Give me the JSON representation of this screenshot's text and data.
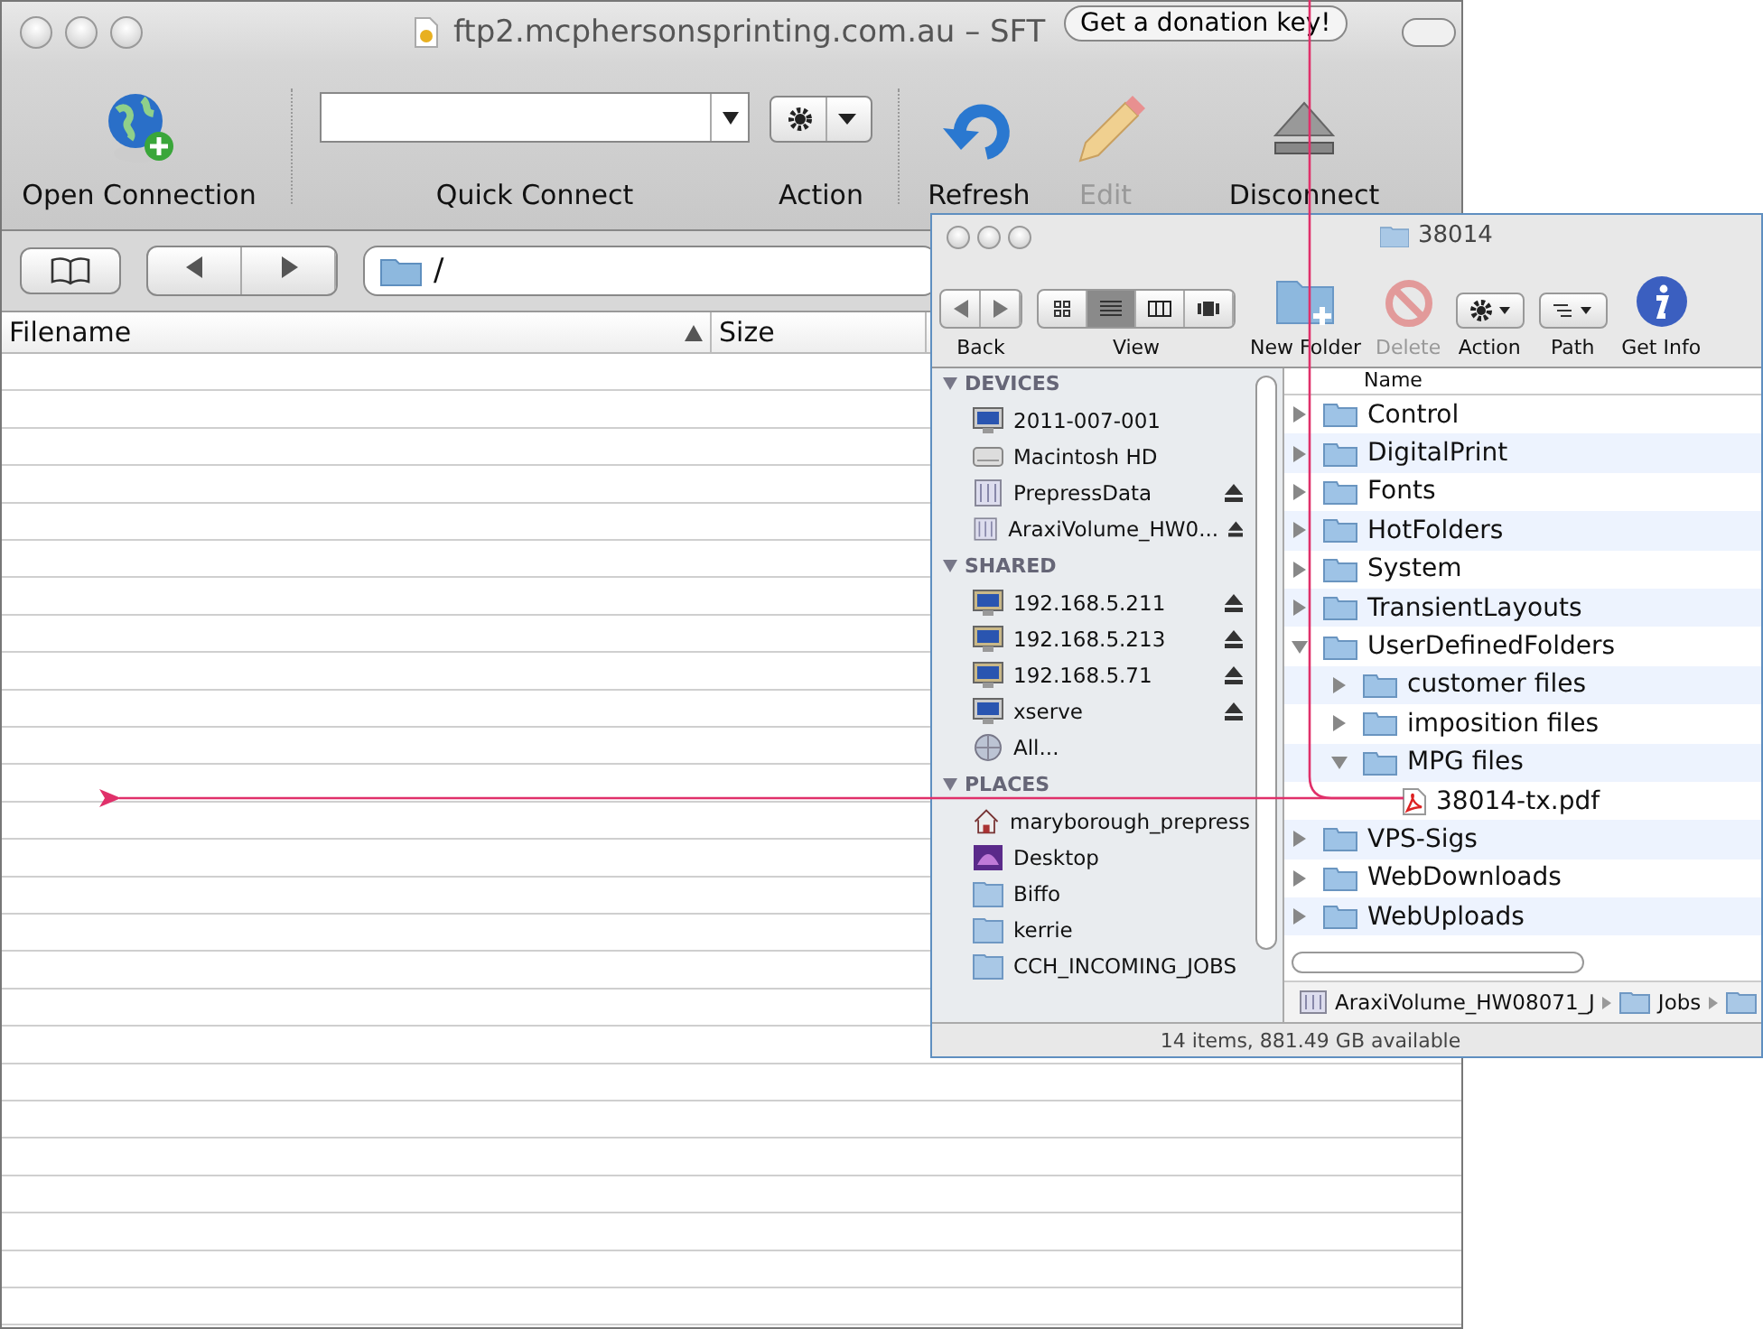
{
  "ftp_window": {
    "title": "ftp2.mcphersonsprinting.com.au – SFT",
    "donation_button": "Get a donation key!",
    "toolbar": [
      {
        "kind": "globe",
        "label": "Open Connection",
        "disabled": false
      },
      {
        "kind": "combo",
        "label": "Quick Connect",
        "disabled": false
      },
      {
        "kind": "gear-menu",
        "label": "Action",
        "disabled": false
      },
      {
        "kind": "refresh",
        "label": "Refresh",
        "disabled": false
      },
      {
        "kind": "pencil",
        "label": "Edit",
        "disabled": true
      },
      {
        "kind": "eject",
        "label": "Disconnect",
        "disabled": false
      }
    ],
    "path": "/",
    "columns": [
      {
        "label": "Filename",
        "sorted": true
      },
      {
        "label": "Size",
        "sorted": false
      }
    ]
  },
  "finder_window": {
    "title": "38014",
    "toolbar": [
      {
        "kind": "nav",
        "label": "Back",
        "disabled": false
      },
      {
        "kind": "view",
        "label": "View",
        "disabled": false
      },
      {
        "kind": "new-folder",
        "label": "New Folder",
        "disabled": false
      },
      {
        "kind": "delete",
        "label": "Delete",
        "disabled": true
      },
      {
        "kind": "action",
        "label": "Action",
        "disabled": false
      },
      {
        "kind": "path",
        "label": "Path",
        "disabled": false
      },
      {
        "kind": "info",
        "label": "Get Info",
        "disabled": false
      }
    ],
    "view_modes": [
      {
        "kind": "icon",
        "selected": false
      },
      {
        "kind": "list",
        "selected": true
      },
      {
        "kind": "columns",
        "selected": false
      },
      {
        "kind": "coverflow",
        "selected": false
      }
    ],
    "sidebar": [
      {
        "heading": "DEVICES",
        "items": [
          {
            "label": "2011-007-001",
            "kind": "computer",
            "ejectable": false
          },
          {
            "label": "Macintosh HD",
            "kind": "disk",
            "ejectable": false
          },
          {
            "label": "PrepressData",
            "kind": "volume",
            "ejectable": true
          },
          {
            "label": "AraxiVolume_HW0...",
            "kind": "volume",
            "ejectable": true
          }
        ]
      },
      {
        "heading": "SHARED",
        "items": [
          {
            "label": "192.168.5.211",
            "kind": "network",
            "ejectable": true
          },
          {
            "label": "192.168.5.213",
            "kind": "network",
            "ejectable": true
          },
          {
            "label": "192.168.5.71",
            "kind": "network",
            "ejectable": true
          },
          {
            "label": "xserve",
            "kind": "server",
            "ejectable": true
          },
          {
            "label": "All...",
            "kind": "globe",
            "ejectable": false
          }
        ]
      },
      {
        "heading": "PLACES",
        "items": [
          {
            "label": "maryborough_prepress",
            "kind": "home",
            "ejectable": false
          },
          {
            "label": "Desktop",
            "kind": "desktop",
            "ejectable": false
          },
          {
            "label": "Biffo",
            "kind": "folder",
            "ejectable": false
          },
          {
            "label": "kerrie",
            "kind": "folder",
            "ejectable": false
          },
          {
            "label": "CCH_INCOMING_JOBS",
            "kind": "folder",
            "ejectable": false
          }
        ]
      }
    ],
    "list_column": "Name",
    "files": [
      {
        "name": "Control",
        "kind": "folder",
        "expanded": false
      },
      {
        "name": "DigitalPrint",
        "kind": "folder",
        "expanded": false
      },
      {
        "name": "Fonts",
        "kind": "folder",
        "expanded": false
      },
      {
        "name": "HotFolders",
        "kind": "folder",
        "expanded": false
      },
      {
        "name": "System",
        "kind": "folder",
        "expanded": false
      },
      {
        "name": "TransientLayouts",
        "kind": "folder",
        "expanded": false
      },
      {
        "name": "UserDefinedFolders",
        "kind": "folder",
        "expanded": true,
        "children": [
          {
            "name": "customer files",
            "kind": "folder",
            "expanded": false
          },
          {
            "name": "imposition files",
            "kind": "folder",
            "expanded": false
          },
          {
            "name": "MPG files",
            "kind": "folder",
            "expanded": true,
            "children": [
              {
                "name": "38014-tx.pdf",
                "kind": "pdf"
              }
            ]
          }
        ]
      },
      {
        "name": "VPS-Sigs",
        "kind": "folder",
        "expanded": false
      },
      {
        "name": "WebDownloads",
        "kind": "folder",
        "expanded": false
      },
      {
        "name": "WebUploads",
        "kind": "folder",
        "expanded": false
      }
    ],
    "path_bar": [
      {
        "label": "AraxiVolume_HW08071_J",
        "kind": "volume"
      },
      {
        "label": "Jobs",
        "kind": "folder"
      },
      {
        "kind": "folder"
      }
    ],
    "status": "14 items, 881.49 GB available"
  }
}
